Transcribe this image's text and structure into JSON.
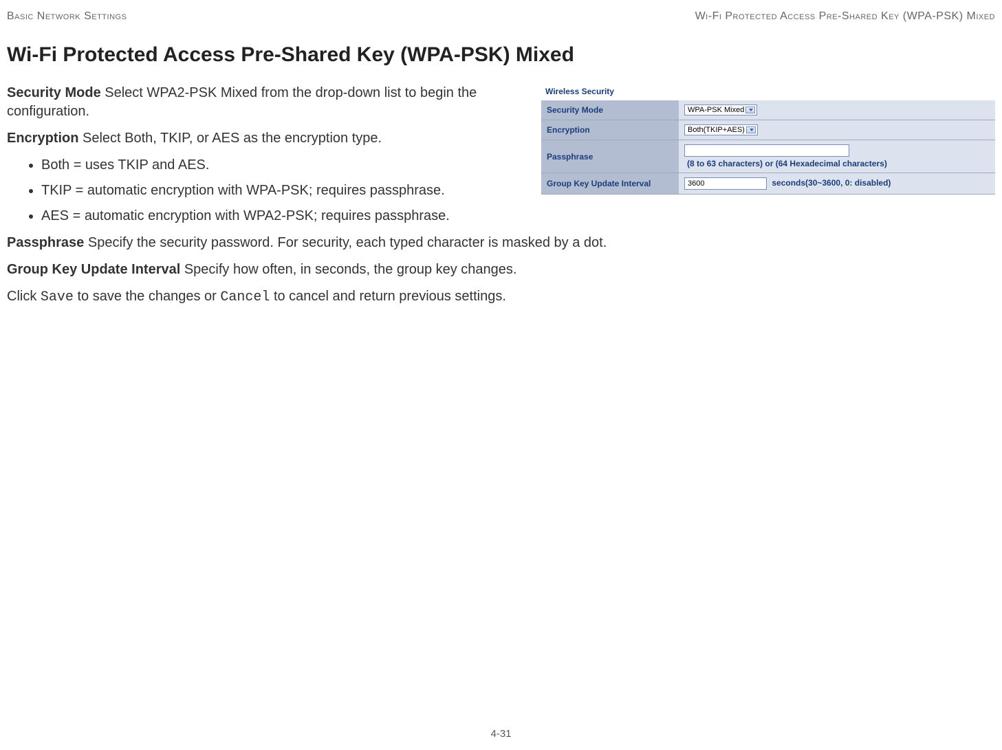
{
  "header": {
    "left": "Basic Network Settings",
    "right": "Wi-Fi Protected Access Pre-Shared Key (WPA-PSK) Mixed"
  },
  "title": "Wi-Fi Protected Access Pre-Shared Key (WPA-PSK) Mixed",
  "panel": {
    "heading": "Wireless Security",
    "rows": {
      "security_mode": {
        "label": "Security Mode",
        "value": "WPA-PSK Mixed"
      },
      "encryption": {
        "label": "Encryption",
        "value": "Both(TKIP+AES)"
      },
      "passphrase": {
        "label": "Passphrase",
        "value": "",
        "hint": "(8 to 63 characters) or (64 Hexadecimal characters)"
      },
      "group_key": {
        "label": "Group Key Update Interval",
        "value": "3600",
        "hint": "seconds(30~3600, 0: disabled)"
      }
    }
  },
  "body": {
    "security_mode_label": "Security Mode",
    "security_mode_text": "  Select WPA2-PSK Mixed from the drop-down list to begin the configuration.",
    "encryption_label": "Encryption",
    "encryption_text": "  Select Both, TKIP, or AES as the encryption type.",
    "bullets": [
      "Both = uses TKIP and AES.",
      "TKIP = automatic encryption with WPA-PSK; requires passphrase.",
      "AES = automatic encryption with WPA2-PSK; requires passphrase."
    ],
    "passphrase_label": "Passphrase",
    "passphrase_text": "  Specify the security password. For security, each typed character is masked by a dot.",
    "group_key_label": "Group Key Update Interval",
    "group_key_text": "  Specify how often, in seconds, the group key changes.",
    "footer_prefix": "Click ",
    "footer_save": "Save",
    "footer_mid": " to save the changes or ",
    "footer_cancel": "Cancel",
    "footer_suffix": " to cancel and return previous settings."
  },
  "page_number": "4-31"
}
